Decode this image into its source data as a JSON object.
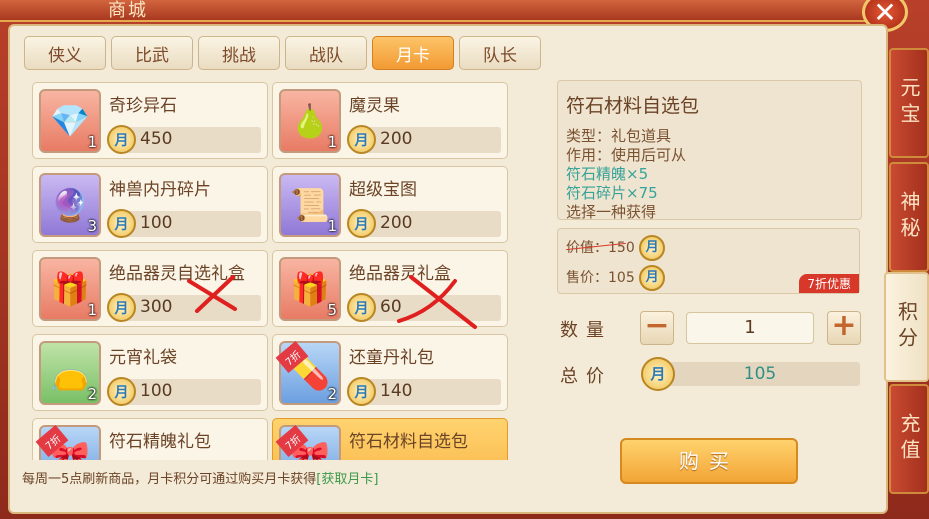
{
  "window": {
    "title": "商城",
    "close_icon": "close-icon"
  },
  "tabs": [
    {
      "label": "侠义",
      "active": false
    },
    {
      "label": "比武",
      "active": false
    },
    {
      "label": "挑战",
      "active": false
    },
    {
      "label": "战队",
      "active": false
    },
    {
      "label": "月卡",
      "active": true
    },
    {
      "label": "队长",
      "active": false
    }
  ],
  "items": [
    {
      "name": "奇珍异石",
      "qty": "1",
      "price": "450",
      "icon": "crystal-icon",
      "quality": "red"
    },
    {
      "name": "魔灵果",
      "qty": "1",
      "price": "200",
      "icon": "fruit-icon",
      "quality": "red"
    },
    {
      "name": "神兽内丹碎片",
      "qty": "3",
      "price": "100",
      "icon": "beast-fragment-icon",
      "quality": "purple"
    },
    {
      "name": "超级宝图",
      "qty": "1",
      "price": "200",
      "icon": "treasure-map-icon",
      "quality": "purple"
    },
    {
      "name": "绝品器灵自选礼盒",
      "qty": "1",
      "price": "300",
      "icon": "gift-box-icon",
      "quality": "red"
    },
    {
      "name": "绝品器灵礼盒",
      "qty": "5",
      "price": "60",
      "icon": "gift-box-icon",
      "quality": "red"
    },
    {
      "name": "元宵礼袋",
      "qty": "2",
      "price": "100",
      "icon": "gift-bag-icon",
      "quality": "green"
    },
    {
      "name": "还童丹礼包",
      "qty": "2",
      "price": "140",
      "icon": "pill-pack-icon",
      "quality": "blue",
      "badge": "7折"
    },
    {
      "name": "符石精魄礼包",
      "qty": "",
      "price": "",
      "icon": "rune-pack-icon",
      "quality": "blue",
      "badge": "7折"
    },
    {
      "name": "符石材料自选包",
      "qty": "",
      "price": "",
      "icon": "rune-pack-icon",
      "quality": "blue",
      "badge": "7折",
      "selected": true
    }
  ],
  "footer": {
    "note": "每周一5点刷新商品，月卡积分可通过购买月卡获得",
    "link": "[获取月卡]"
  },
  "detail": {
    "title": "符石材料自选包",
    "line_type": "类型：礼包道具",
    "line_use": "作用：使用后可从",
    "line_item1": "符石精魄×5",
    "line_item2": "符石碎片×75",
    "line_more": "选择一种获得"
  },
  "price_box": {
    "original_label": "价值：150",
    "sale_label": "售价：105",
    "discount_tag": "7折优惠"
  },
  "purchase": {
    "qty_label": "数量",
    "minus": "−",
    "qty_value": "1",
    "plus": "+",
    "total_label": "总价",
    "total_value": "105",
    "buy_label": "购买"
  },
  "coin_glyph": "月",
  "side_tabs": [
    {
      "label": "元宝",
      "active": false
    },
    {
      "label": "神秘",
      "active": false
    },
    {
      "label": "积分",
      "active": true
    },
    {
      "label": "充值",
      "active": false
    }
  ],
  "colors": {
    "accent": "#f29a33",
    "frame": "#a9391f",
    "panel": "#f3ead7",
    "green_text": "#36a39a",
    "discount_red": "#d7382a"
  }
}
